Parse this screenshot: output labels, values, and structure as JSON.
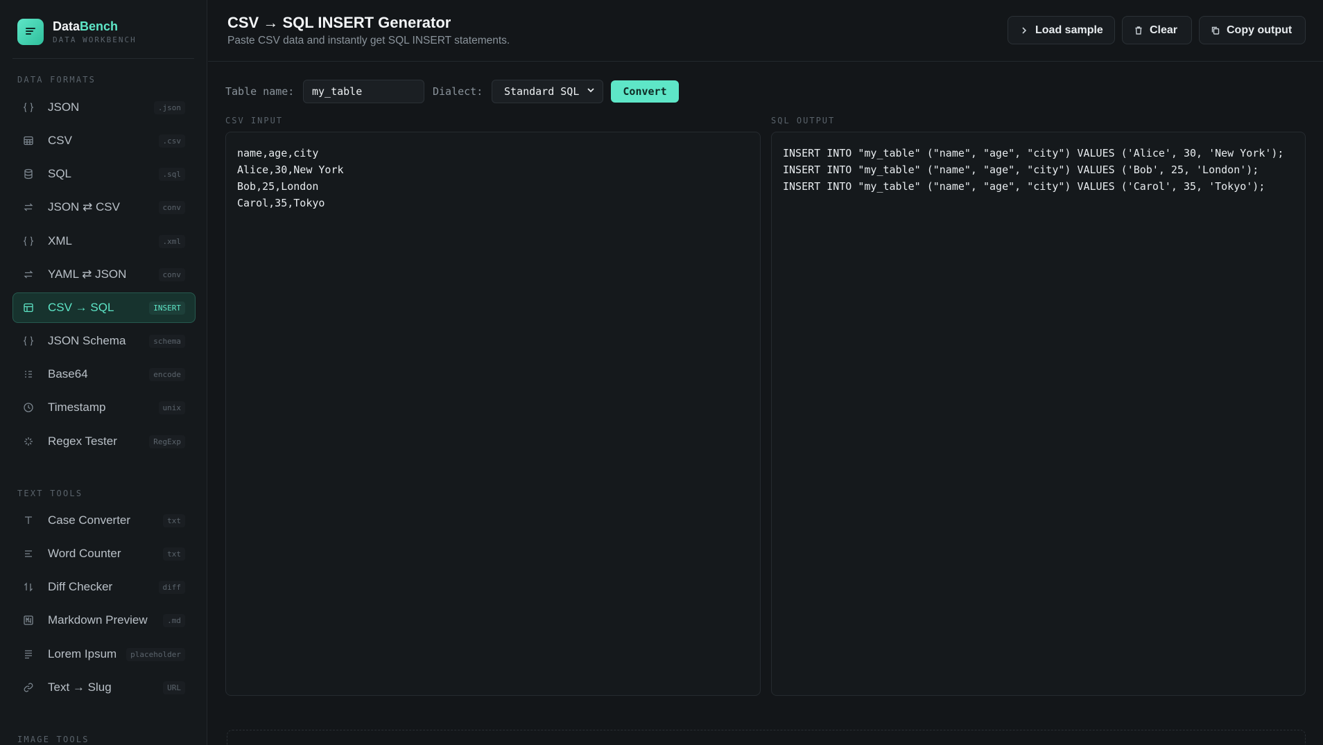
{
  "brand": {
    "name_a": "Data",
    "name_b": "Bench",
    "subtitle": "DATA WORKBENCH"
  },
  "sections": {
    "data_formats": "DATA FORMATS",
    "text_tools": "TEXT TOOLS",
    "image_tools": "IMAGE TOOLS"
  },
  "nav": {
    "data": [
      {
        "label": "JSON",
        "tag": ".json",
        "icon": "braces-icon"
      },
      {
        "label": "CSV",
        "tag": ".csv",
        "icon": "table-icon"
      },
      {
        "label": "SQL",
        "tag": ".sql",
        "icon": "database-icon"
      },
      {
        "label": "JSON ⇄ CSV",
        "tag": "conv",
        "icon": "swap-icon"
      },
      {
        "label": "XML",
        "tag": ".xml",
        "icon": "braces-icon"
      },
      {
        "label": "YAML ⇄ JSON",
        "tag": "conv",
        "icon": "swap-icon"
      },
      {
        "label": "CSV → SQL",
        "tag": "INSERT",
        "icon": "table-icon",
        "active": true
      },
      {
        "label": "JSON Schema",
        "tag": "schema",
        "icon": "braces-icon"
      },
      {
        "label": "Base64",
        "tag": "encode",
        "icon": "list-icon"
      },
      {
        "label": "Timestamp",
        "tag": "unix",
        "icon": "clock-icon"
      },
      {
        "label": "Regex Tester",
        "tag": "RegExp",
        "icon": "sparkle-icon"
      }
    ],
    "text": [
      {
        "label": "Case Converter",
        "tag": "txt",
        "icon": "type-icon"
      },
      {
        "label": "Word Counter",
        "tag": "txt",
        "icon": "lines-icon"
      },
      {
        "label": "Diff Checker",
        "tag": "diff",
        "icon": "arrows-updown-icon"
      },
      {
        "label": "Markdown Preview",
        "tag": ".md",
        "icon": "markdown-icon"
      },
      {
        "label": "Lorem Ipsum",
        "tag": "placeholder",
        "icon": "paragraph-icon"
      },
      {
        "label": "Text → Slug",
        "tag": "URL",
        "icon": "link-icon"
      }
    ]
  },
  "header": {
    "title": "CSV → SQL INSERT Generator",
    "subtitle": "Paste CSV data and instantly get SQL INSERT statements.",
    "buttons": {
      "load_sample": "Load sample",
      "clear": "Clear",
      "copy_output": "Copy output"
    }
  },
  "controls": {
    "table_name_label": "Table name:",
    "table_name_value": "my_table",
    "dialect_label": "Dialect:",
    "dialect_value": "Standard SQL",
    "convert_label": "Convert"
  },
  "panes": {
    "input_label": "CSV INPUT",
    "output_label": "SQL OUTPUT",
    "input_lines": [
      "name,age,city",
      "Alice,30,New York",
      "Bob,25,London",
      "Carol,35,Tokyo"
    ],
    "output_lines": [
      "INSERT INTO \"my_table\" (\"name\", \"age\", \"city\") VALUES ('Alice', 30, 'New York');",
      "INSERT INTO \"my_table\" (\"name\", \"age\", \"city\") VALUES ('Bob', 25, 'London');",
      "INSERT INTO \"my_table\" (\"name\", \"age\", \"city\") VALUES ('Carol', 35, 'Tokyo');"
    ]
  },
  "colors": {
    "accent": "#5ee6c7",
    "background": "#131619",
    "sidebar": "#15191c"
  }
}
